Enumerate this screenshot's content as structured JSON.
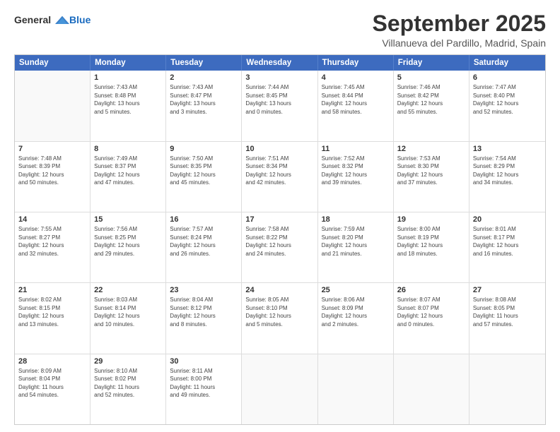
{
  "header": {
    "logo_line1": "General",
    "logo_line2": "Blue",
    "month": "September 2025",
    "location": "Villanueva del Pardillo, Madrid, Spain"
  },
  "weekdays": [
    "Sunday",
    "Monday",
    "Tuesday",
    "Wednesday",
    "Thursday",
    "Friday",
    "Saturday"
  ],
  "rows": [
    [
      {
        "day": "",
        "lines": []
      },
      {
        "day": "1",
        "lines": [
          "Sunrise: 7:43 AM",
          "Sunset: 8:48 PM",
          "Daylight: 13 hours",
          "and 5 minutes."
        ]
      },
      {
        "day": "2",
        "lines": [
          "Sunrise: 7:43 AM",
          "Sunset: 8:47 PM",
          "Daylight: 13 hours",
          "and 3 minutes."
        ]
      },
      {
        "day": "3",
        "lines": [
          "Sunrise: 7:44 AM",
          "Sunset: 8:45 PM",
          "Daylight: 13 hours",
          "and 0 minutes."
        ]
      },
      {
        "day": "4",
        "lines": [
          "Sunrise: 7:45 AM",
          "Sunset: 8:44 PM",
          "Daylight: 12 hours",
          "and 58 minutes."
        ]
      },
      {
        "day": "5",
        "lines": [
          "Sunrise: 7:46 AM",
          "Sunset: 8:42 PM",
          "Daylight: 12 hours",
          "and 55 minutes."
        ]
      },
      {
        "day": "6",
        "lines": [
          "Sunrise: 7:47 AM",
          "Sunset: 8:40 PM",
          "Daylight: 12 hours",
          "and 52 minutes."
        ]
      }
    ],
    [
      {
        "day": "7",
        "lines": [
          "Sunrise: 7:48 AM",
          "Sunset: 8:39 PM",
          "Daylight: 12 hours",
          "and 50 minutes."
        ]
      },
      {
        "day": "8",
        "lines": [
          "Sunrise: 7:49 AM",
          "Sunset: 8:37 PM",
          "Daylight: 12 hours",
          "and 47 minutes."
        ]
      },
      {
        "day": "9",
        "lines": [
          "Sunrise: 7:50 AM",
          "Sunset: 8:35 PM",
          "Daylight: 12 hours",
          "and 45 minutes."
        ]
      },
      {
        "day": "10",
        "lines": [
          "Sunrise: 7:51 AM",
          "Sunset: 8:34 PM",
          "Daylight: 12 hours",
          "and 42 minutes."
        ]
      },
      {
        "day": "11",
        "lines": [
          "Sunrise: 7:52 AM",
          "Sunset: 8:32 PM",
          "Daylight: 12 hours",
          "and 39 minutes."
        ]
      },
      {
        "day": "12",
        "lines": [
          "Sunrise: 7:53 AM",
          "Sunset: 8:30 PM",
          "Daylight: 12 hours",
          "and 37 minutes."
        ]
      },
      {
        "day": "13",
        "lines": [
          "Sunrise: 7:54 AM",
          "Sunset: 8:29 PM",
          "Daylight: 12 hours",
          "and 34 minutes."
        ]
      }
    ],
    [
      {
        "day": "14",
        "lines": [
          "Sunrise: 7:55 AM",
          "Sunset: 8:27 PM",
          "Daylight: 12 hours",
          "and 32 minutes."
        ]
      },
      {
        "day": "15",
        "lines": [
          "Sunrise: 7:56 AM",
          "Sunset: 8:25 PM",
          "Daylight: 12 hours",
          "and 29 minutes."
        ]
      },
      {
        "day": "16",
        "lines": [
          "Sunrise: 7:57 AM",
          "Sunset: 8:24 PM",
          "Daylight: 12 hours",
          "and 26 minutes."
        ]
      },
      {
        "day": "17",
        "lines": [
          "Sunrise: 7:58 AM",
          "Sunset: 8:22 PM",
          "Daylight: 12 hours",
          "and 24 minutes."
        ]
      },
      {
        "day": "18",
        "lines": [
          "Sunrise: 7:59 AM",
          "Sunset: 8:20 PM",
          "Daylight: 12 hours",
          "and 21 minutes."
        ]
      },
      {
        "day": "19",
        "lines": [
          "Sunrise: 8:00 AM",
          "Sunset: 8:19 PM",
          "Daylight: 12 hours",
          "and 18 minutes."
        ]
      },
      {
        "day": "20",
        "lines": [
          "Sunrise: 8:01 AM",
          "Sunset: 8:17 PM",
          "Daylight: 12 hours",
          "and 16 minutes."
        ]
      }
    ],
    [
      {
        "day": "21",
        "lines": [
          "Sunrise: 8:02 AM",
          "Sunset: 8:15 PM",
          "Daylight: 12 hours",
          "and 13 minutes."
        ]
      },
      {
        "day": "22",
        "lines": [
          "Sunrise: 8:03 AM",
          "Sunset: 8:14 PM",
          "Daylight: 12 hours",
          "and 10 minutes."
        ]
      },
      {
        "day": "23",
        "lines": [
          "Sunrise: 8:04 AM",
          "Sunset: 8:12 PM",
          "Daylight: 12 hours",
          "and 8 minutes."
        ]
      },
      {
        "day": "24",
        "lines": [
          "Sunrise: 8:05 AM",
          "Sunset: 8:10 PM",
          "Daylight: 12 hours",
          "and 5 minutes."
        ]
      },
      {
        "day": "25",
        "lines": [
          "Sunrise: 8:06 AM",
          "Sunset: 8:09 PM",
          "Daylight: 12 hours",
          "and 2 minutes."
        ]
      },
      {
        "day": "26",
        "lines": [
          "Sunrise: 8:07 AM",
          "Sunset: 8:07 PM",
          "Daylight: 12 hours",
          "and 0 minutes."
        ]
      },
      {
        "day": "27",
        "lines": [
          "Sunrise: 8:08 AM",
          "Sunset: 8:05 PM",
          "Daylight: 11 hours",
          "and 57 minutes."
        ]
      }
    ],
    [
      {
        "day": "28",
        "lines": [
          "Sunrise: 8:09 AM",
          "Sunset: 8:04 PM",
          "Daylight: 11 hours",
          "and 54 minutes."
        ]
      },
      {
        "day": "29",
        "lines": [
          "Sunrise: 8:10 AM",
          "Sunset: 8:02 PM",
          "Daylight: 11 hours",
          "and 52 minutes."
        ]
      },
      {
        "day": "30",
        "lines": [
          "Sunrise: 8:11 AM",
          "Sunset: 8:00 PM",
          "Daylight: 11 hours",
          "and 49 minutes."
        ]
      },
      {
        "day": "",
        "lines": []
      },
      {
        "day": "",
        "lines": []
      },
      {
        "day": "",
        "lines": []
      },
      {
        "day": "",
        "lines": []
      }
    ]
  ]
}
